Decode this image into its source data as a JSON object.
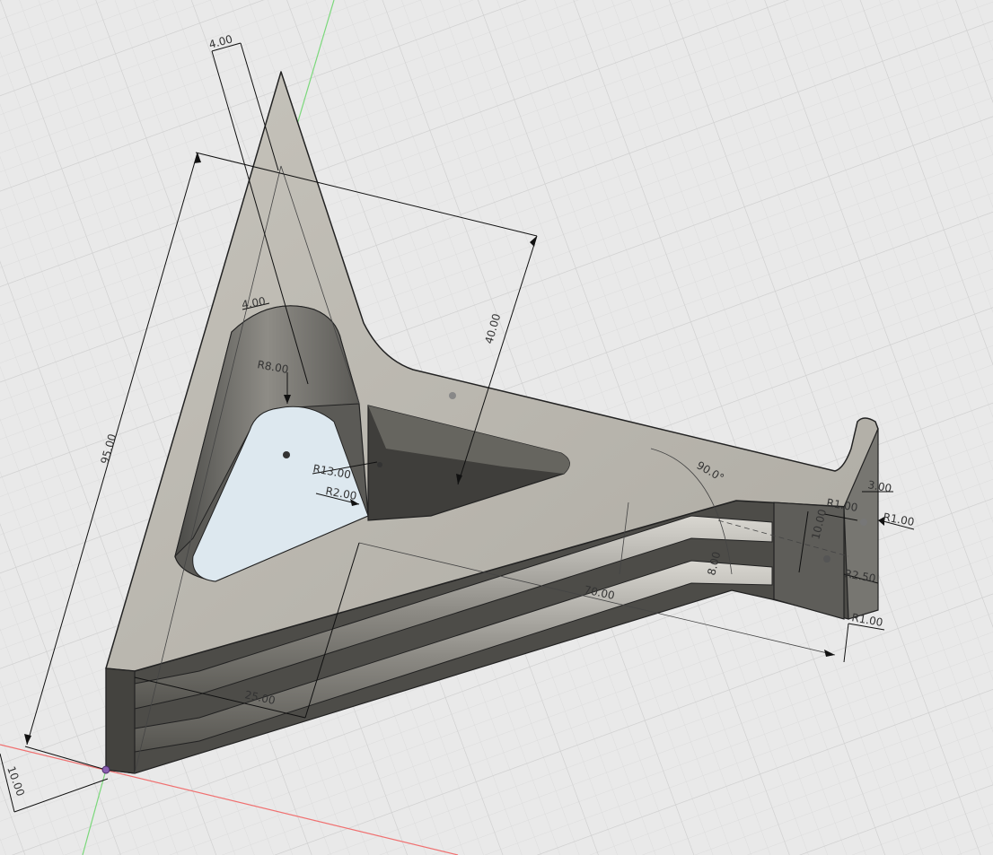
{
  "viewport": {
    "background": "#e9e9e9",
    "grid_minor": "#dcdcdc",
    "grid_major": "#cfcfcf",
    "axis_x_color": "#f07070",
    "axis_y_color": "#7bd87b"
  },
  "part": {
    "face_color": "#b9b6ae",
    "edge_color": "#222222",
    "hole_tint": "#dde8ef"
  },
  "dimensions": {
    "d_4_top": "4.00",
    "d_4_inner": "4.00",
    "d_95": "95.00",
    "d_40": "40.00",
    "d_r8": "R8.00",
    "d_r13": "R13.00",
    "d_r2": "R2.00",
    "d_angle": "90.0°",
    "d_3": "3.00",
    "d_r1_a": "R1.00",
    "d_r1_b": "R1.00",
    "d_10_right": "10.00",
    "d_r250": "R2.50",
    "d_r1_c": "R1.00",
    "d_8": "8.00",
    "d_70": "70.00",
    "d_25": "25.00",
    "d_10_bottom": "10.00"
  }
}
